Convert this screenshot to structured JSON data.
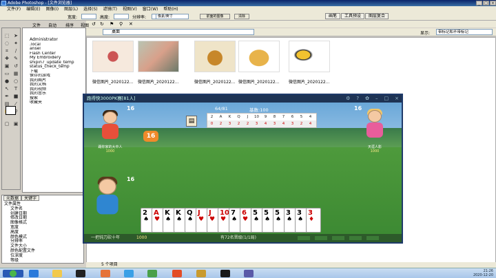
{
  "app": {
    "title": "Adobe Photoshop - [文件浏览器]"
  },
  "menu": [
    "文件(F)",
    "编辑(E)",
    "图像(I)",
    "图层(L)",
    "选择(S)",
    "滤镜(T)",
    "视图(V)",
    "窗口(W)",
    "帮助(H)"
  ],
  "options": {
    "width_label": "宽度:",
    "height_label": "高度:",
    "res_label": "分辨率:",
    "units": "像素/英寸",
    "front_btn": "前面的图像",
    "clear_btn": "清除"
  },
  "palette_tabs": [
    "画笔",
    "工具预设",
    "图层复合"
  ],
  "browser": {
    "toolbar": [
      "文件",
      "自动",
      "排序",
      "视图"
    ],
    "path": "桌面",
    "sort_label": "显示:",
    "sort_value": "带标记和不带标记"
  },
  "folders": [
    "Administrator",
    ".local",
    "ansel",
    "Flash Center",
    "My Embroidery",
    "shipin7_update_temp",
    "status_check_temp",
    "下载",
    "保存的游戏",
    "我的图片",
    "我的文档",
    "我的视频",
    "我的音乐",
    "搜索",
    "收藏夹"
  ],
  "thumbnails": [
    "微信图片_2020122...",
    "微信图片_2020122...",
    "微信图片_2020122...",
    "微信图片_2020122...",
    "微信图片_2020122..."
  ],
  "status": "5 个项目",
  "metadata": {
    "tabs": [
      "元数据",
      "关键字"
    ],
    "section": "文件属性",
    "rows": [
      "文件名",
      "创建日期",
      "修改日期",
      "图像格式",
      "宽度",
      "高度",
      "颜色模式",
      "分辨率",
      "文件大小",
      "颜色配置文件",
      "位深度",
      "等级"
    ]
  },
  "game": {
    "title": "跑得快3000PK赛[81人]",
    "progress": "64/81",
    "base": "基数:100",
    "mini_ranks": [
      "2",
      "A",
      "K",
      "Q",
      "J",
      "10",
      "9",
      "8",
      "7",
      "6",
      "5",
      "4",
      "3"
    ],
    "mini_counts": [
      "0",
      "2",
      "3",
      "2",
      "2",
      "3",
      "4",
      "3",
      "4",
      "3",
      "2",
      "4",
      "2"
    ],
    "left_score": "16",
    "right_score": "16",
    "bottom_score": "16",
    "badge": "16",
    "left_player": "踢你家的大中人",
    "left_chips": "1000",
    "right_player": "天涯人影",
    "right_chips": "1000",
    "hand": [
      {
        "rank": "2",
        "suit": "♠",
        "color": "#000"
      },
      {
        "rank": "A",
        "suit": "♥",
        "color": "#c00"
      },
      {
        "rank": "K",
        "suit": "♠",
        "color": "#000"
      },
      {
        "rank": "K",
        "suit": "♠",
        "color": "#000"
      },
      {
        "rank": "Q",
        "suit": "♠",
        "color": "#000"
      },
      {
        "rank": "J",
        "suit": "♥",
        "color": "#c00"
      },
      {
        "rank": "J",
        "suit": "♥",
        "color": "#c00"
      },
      {
        "rank": "10",
        "suit": "♥",
        "color": "#c00"
      },
      {
        "rank": "7",
        "suit": "♠",
        "color": "#000"
      },
      {
        "rank": "6",
        "suit": "♥",
        "color": "#c00"
      },
      {
        "rank": "5",
        "suit": "♠",
        "color": "#000"
      },
      {
        "rank": "5",
        "suit": "♠",
        "color": "#000"
      },
      {
        "rank": "5",
        "suit": "♠",
        "color": "#000"
      },
      {
        "rank": "3",
        "suit": "♠",
        "color": "#000"
      },
      {
        "rank": "3",
        "suit": "♠",
        "color": "#000"
      },
      {
        "rank": "3",
        "suit": "♦",
        "color": "#c00"
      }
    ],
    "footer_left": "一把钝刀砍十年",
    "footer_chips": "1000",
    "footer_center": "有72名晋级(1/1局)"
  },
  "taskbar": {
    "time": "21:26",
    "date": "2020-12-20"
  }
}
